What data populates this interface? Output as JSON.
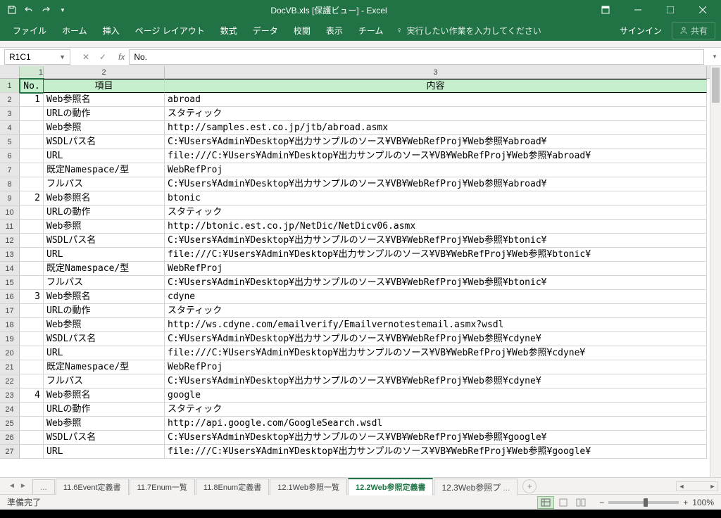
{
  "title": "DocVB.xls  [保護ビュー] - Excel",
  "qat": {
    "save": "save",
    "undo": "undo",
    "redo": "redo"
  },
  "ribbon": {
    "file": "ファイル",
    "home": "ホーム",
    "insert": "挿入",
    "pagelayout": "ページ レイアウト",
    "formulas": "数式",
    "data": "データ",
    "review": "校閲",
    "view": "表示",
    "team": "チーム",
    "tellme": "実行したい作業を入力してください",
    "signin": "サインイン",
    "share": "共有"
  },
  "namebox": "R1C1",
  "formula": "No.",
  "columns": [
    "1",
    "2",
    "3"
  ],
  "headerRow": {
    "no": "No.",
    "item": "項目",
    "content": "内容"
  },
  "rows": [
    {
      "r": "2",
      "no": "1",
      "item": "Web参照名",
      "content": "abroad"
    },
    {
      "r": "3",
      "no": "",
      "item": "URLの動作",
      "content": "スタティック"
    },
    {
      "r": "4",
      "no": "",
      "item": "Web参照",
      "content": "http://samples.est.co.jp/jtb/abroad.asmx"
    },
    {
      "r": "5",
      "no": "",
      "item": "WSDLパス名",
      "content": "C:¥Users¥Admin¥Desktop¥出力サンプルのソース¥VB¥WebRefProj¥Web参照¥abroad¥"
    },
    {
      "r": "6",
      "no": "",
      "item": "URL",
      "content": "file:///C:¥Users¥Admin¥Desktop¥出力サンプルのソース¥VB¥WebRefProj¥Web参照¥abroad¥"
    },
    {
      "r": "7",
      "no": "",
      "item": "既定Namespace/型",
      "content": "WebRefProj"
    },
    {
      "r": "8",
      "no": "",
      "item": "フルパス",
      "content": "C:¥Users¥Admin¥Desktop¥出力サンプルのソース¥VB¥WebRefProj¥Web参照¥abroad¥"
    },
    {
      "r": "9",
      "no": "2",
      "item": "Web参照名",
      "content": "btonic"
    },
    {
      "r": "10",
      "no": "",
      "item": "URLの動作",
      "content": "スタティック"
    },
    {
      "r": "11",
      "no": "",
      "item": "Web参照",
      "content": "http://btonic.est.co.jp/NetDic/NetDicv06.asmx"
    },
    {
      "r": "12",
      "no": "",
      "item": "WSDLパス名",
      "content": "C:¥Users¥Admin¥Desktop¥出力サンプルのソース¥VB¥WebRefProj¥Web参照¥btonic¥"
    },
    {
      "r": "13",
      "no": "",
      "item": "URL",
      "content": "file:///C:¥Users¥Admin¥Desktop¥出力サンプルのソース¥VB¥WebRefProj¥Web参照¥btonic¥"
    },
    {
      "r": "14",
      "no": "",
      "item": "既定Namespace/型",
      "content": "WebRefProj"
    },
    {
      "r": "15",
      "no": "",
      "item": "フルパス",
      "content": "C:¥Users¥Admin¥Desktop¥出力サンプルのソース¥VB¥WebRefProj¥Web参照¥btonic¥"
    },
    {
      "r": "16",
      "no": "3",
      "item": "Web参照名",
      "content": "cdyne"
    },
    {
      "r": "17",
      "no": "",
      "item": "URLの動作",
      "content": "スタティック"
    },
    {
      "r": "18",
      "no": "",
      "item": "Web参照",
      "content": "http://ws.cdyne.com/emailverify/Emailvernotestemail.asmx?wsdl"
    },
    {
      "r": "19",
      "no": "",
      "item": "WSDLパス名",
      "content": "C:¥Users¥Admin¥Desktop¥出力サンプルのソース¥VB¥WebRefProj¥Web参照¥cdyne¥"
    },
    {
      "r": "20",
      "no": "",
      "item": "URL",
      "content": "file:///C:¥Users¥Admin¥Desktop¥出力サンプルのソース¥VB¥WebRefProj¥Web参照¥cdyne¥"
    },
    {
      "r": "21",
      "no": "",
      "item": "既定Namespace/型",
      "content": "WebRefProj"
    },
    {
      "r": "22",
      "no": "",
      "item": "フルパス",
      "content": "C:¥Users¥Admin¥Desktop¥出力サンプルのソース¥VB¥WebRefProj¥Web参照¥cdyne¥"
    },
    {
      "r": "23",
      "no": "4",
      "item": "Web参照名",
      "content": "google"
    },
    {
      "r": "24",
      "no": "",
      "item": "URLの動作",
      "content": "スタティック"
    },
    {
      "r": "25",
      "no": "",
      "item": "Web参照",
      "content": "http://api.google.com/GoogleSearch.wsdl"
    },
    {
      "r": "26",
      "no": "",
      "item": "WSDLパス名",
      "content": "C:¥Users¥Admin¥Desktop¥出力サンプルのソース¥VB¥WebRefProj¥Web参照¥google¥"
    },
    {
      "r": "27",
      "no": "",
      "item": "URL",
      "content": "file:///C:¥Users¥Admin¥Desktop¥出力サンプルのソース¥VB¥WebRefProj¥Web参照¥google¥"
    }
  ],
  "sheets": {
    "prev": "...",
    "t1": "11.6Event定義書",
    "t2": "11.7Enum一覧",
    "t3": "11.8Enum定義書",
    "t4": "12.1Web参照一覧",
    "t5": "12.2Web参照定義書",
    "t6": "12.3Web参照プ",
    "next": "..."
  },
  "status": {
    "ready": "準備完了",
    "zoom": "100%"
  }
}
